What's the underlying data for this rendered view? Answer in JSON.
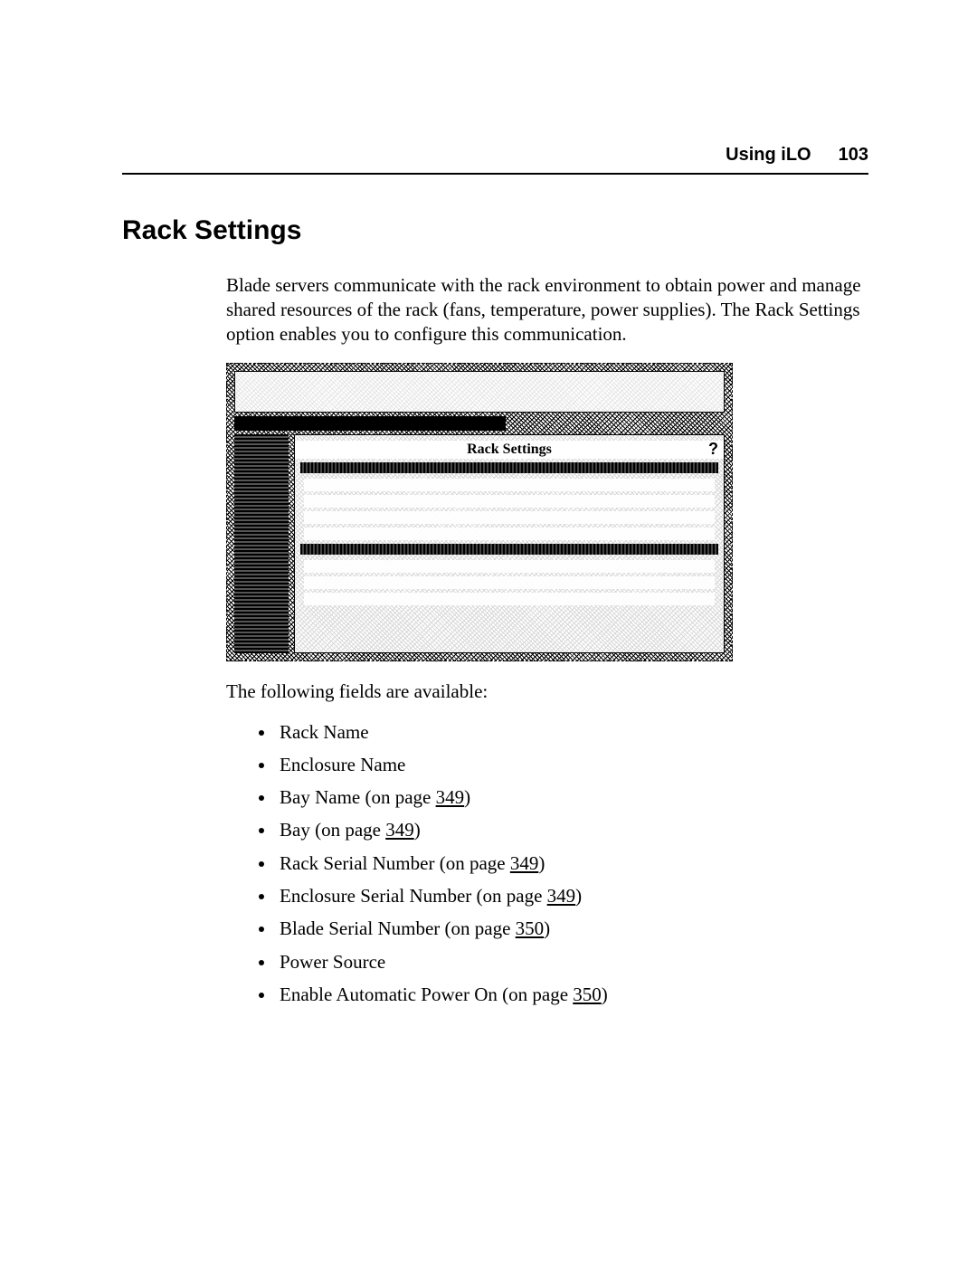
{
  "header": {
    "section": "Using iLO",
    "page_number": "103"
  },
  "title": "Rack Settings",
  "intro": "Blade servers communicate with the rack environment to obtain power and manage shared resources of the rack (fans, temperature, power supplies). The Rack Settings option enables you to configure this communication.",
  "screenshot": {
    "panel_title": "Rack Settings",
    "help_icon": "?"
  },
  "fields_lead": "The following fields are available:",
  "fields": [
    {
      "label": "Rack Name"
    },
    {
      "label": "Enclosure Name"
    },
    {
      "label": "Bay Name",
      "on_page_prefix": " (on page ",
      "page_ref": "349",
      "suffix": ")"
    },
    {
      "label": "Bay",
      "on_page_prefix": " (on page ",
      "page_ref": "349",
      "suffix": ")"
    },
    {
      "label": "Rack Serial Number",
      "on_page_prefix": " (on page ",
      "page_ref": "349",
      "suffix": ")"
    },
    {
      "label": "Enclosure Serial Number",
      "on_page_prefix": " (on page ",
      "page_ref": "349",
      "suffix": ")"
    },
    {
      "label": "Blade Serial Number",
      "on_page_prefix": " (on page ",
      "page_ref": "350",
      "suffix": ")"
    },
    {
      "label": "Power Source"
    },
    {
      "label": "Enable Automatic Power On",
      "on_page_prefix": " (on page ",
      "page_ref": "350",
      "suffix": ")"
    }
  ]
}
